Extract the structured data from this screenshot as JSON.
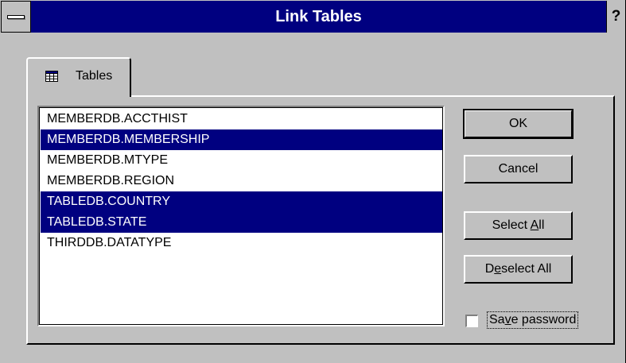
{
  "window": {
    "title": "Link Tables",
    "help": "?"
  },
  "tab": {
    "label": "Tables",
    "icon": "table-icon"
  },
  "tables": [
    {
      "name": "MEMBERDB.ACCTHIST",
      "selected": false
    },
    {
      "name": "MEMBERDB.MEMBERSHIP",
      "selected": true
    },
    {
      "name": "MEMBERDB.MTYPE",
      "selected": false
    },
    {
      "name": "MEMBERDB.REGION",
      "selected": false
    },
    {
      "name": "TABLEDB.COUNTRY",
      "selected": true
    },
    {
      "name": "TABLEDB.STATE",
      "selected": true
    },
    {
      "name": "THIRDDB.DATATYPE",
      "selected": false
    }
  ],
  "buttons": {
    "ok": "OK",
    "cancel": "Cancel",
    "select_all": {
      "before": "Select ",
      "key": "A",
      "after": "ll"
    },
    "deselect_all": {
      "before": "D",
      "key": "e",
      "after": "select All"
    }
  },
  "save_password": {
    "checked": false,
    "before": "Sa",
    "key": "v",
    "after": "e password"
  },
  "colors": {
    "titlebar": "#000080",
    "selection": "#000080",
    "face": "#c0c0c0"
  }
}
